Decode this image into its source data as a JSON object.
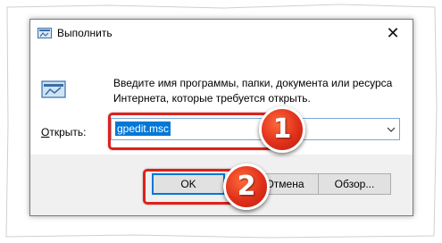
{
  "window": {
    "title": "Выполнить",
    "close_glyph": "✕"
  },
  "description": "Введите имя программы, папки, документа или ресурса Интернета, которые требуется открыть.",
  "open_field": {
    "label_underlined": "О",
    "label_rest": "ткрыть:",
    "value": "gpedit.msc"
  },
  "buttons": {
    "ok": "OK",
    "cancel": "Отмена",
    "browse": "Обзор..."
  },
  "annotations": {
    "step1": "1",
    "step2": "2"
  },
  "colors": {
    "highlight": "#e0201a",
    "selection": "#0078d7"
  },
  "icons": [
    "run-app-icon",
    "close-icon",
    "chevron-down-icon"
  ]
}
